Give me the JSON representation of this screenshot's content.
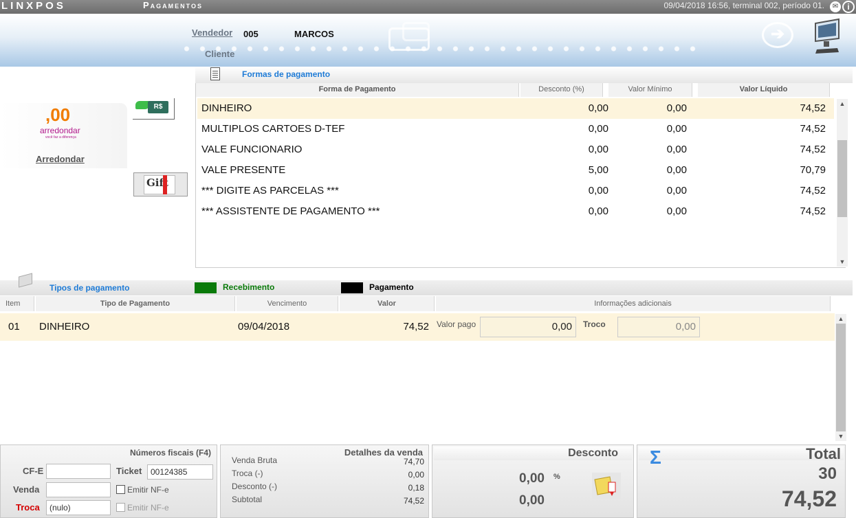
{
  "titlebar": {
    "app_logo": "LINXPOS",
    "screen_title": "Pagamentos",
    "session_info": "09/04/2018 16:56, terminal 002, período 01."
  },
  "header": {
    "vendedor_label": "Vendedor",
    "vendedor_code": "005",
    "vendedor_name": "MARCOS",
    "cliente_label": "Cliente"
  },
  "left": {
    "round_amount": ",00",
    "round_brand": "arredondar",
    "round_slogan": "você faz a diferença",
    "round_label": "Arredondar",
    "money_button_text": "R$",
    "gift_button_text": "Gift"
  },
  "formas": {
    "title": "Formas de pagamento",
    "columns": [
      "Forma de Pagamento",
      "Desconto (%)",
      "Valor Mínimo",
      "Valor Líquido"
    ],
    "rows": [
      {
        "name": "DINHEIRO",
        "desconto": "0,00",
        "minimo": "0,00",
        "liquido": "74,52"
      },
      {
        "name": "MULTIPLOS CARTOES D-TEF",
        "desconto": "0,00",
        "minimo": "0,00",
        "liquido": "74,52"
      },
      {
        "name": "VALE FUNCIONARIO",
        "desconto": "0,00",
        "minimo": "0,00",
        "liquido": "74,52"
      },
      {
        "name": "VALE PRESENTE",
        "desconto": "5,00",
        "minimo": "0,00",
        "liquido": "70,79"
      },
      {
        "name": "*** DIGITE AS PARCELAS ***",
        "desconto": "0,00",
        "minimo": "0,00",
        "liquido": "74,52"
      },
      {
        "name": "*** ASSISTENTE DE PAGAMENTO ***",
        "desconto": "0,00",
        "minimo": "0,00",
        "liquido": "74,52"
      }
    ]
  },
  "tipos": {
    "title": "Tipos de pagamento",
    "legend_recebimento": "Recebimento",
    "legend_pagamento": "Pagamento",
    "columns": [
      "Item",
      "Tipo de Pagamento",
      "Vencimento",
      "Valor",
      "Informações adicionais"
    ],
    "row": {
      "item": "01",
      "tipo": "DINHEIRO",
      "vencimento": "09/04/2018",
      "valor": "74,52",
      "valor_pago_label": "Valor pago",
      "valor_pago": "0,00",
      "troco_label": "Troco",
      "troco": "0,00"
    }
  },
  "fiscal": {
    "title": "Números fiscais (F4)",
    "cfe_label": "CF-E",
    "cfe_value": "",
    "ticket_label": "Ticket",
    "ticket_value": "00124385",
    "venda_label": "Venda",
    "venda_value": "",
    "emitir_nfe_label_1": "Emitir NF-e",
    "troca_label": "Troca",
    "troca_value": "(nulo)",
    "emitir_nfe_label_2": "Emitir NF-e"
  },
  "detalhes": {
    "title": "Detalhes da venda",
    "items": [
      {
        "label": "Venda Bruta",
        "value": "74,70"
      },
      {
        "label": "Troca (-)",
        "value": "0,00"
      },
      {
        "label": "Desconto (-)",
        "value": "0,18"
      },
      {
        "label": "Subtotal",
        "value": "74,52"
      }
    ]
  },
  "desconto": {
    "title": "Desconto",
    "percent_value": "0,00",
    "percent_symbol": "%",
    "amount_value": "0,00"
  },
  "total": {
    "title": "Total",
    "sigma": "Σ",
    "quantity": "30",
    "amount": "74,52"
  },
  "colors": {
    "accent_blue": "#1e7bd6",
    "selected_row": "#fdf4dc",
    "recebimento": "#0a7a0a",
    "pagamento": "#000000",
    "troca_red": "#d40000"
  }
}
